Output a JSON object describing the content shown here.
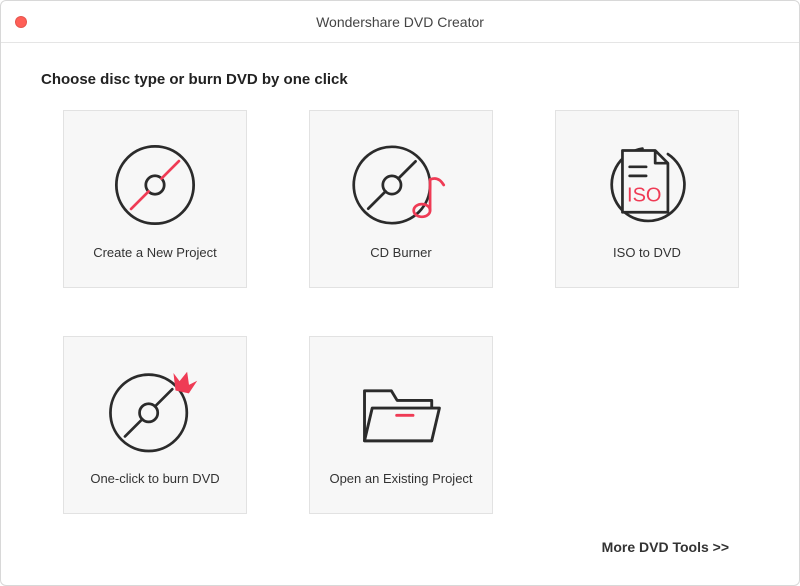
{
  "window": {
    "title": "Wondershare DVD Creator"
  },
  "heading": "Choose disc type or burn DVD by one click",
  "tiles": {
    "create_new_project": {
      "label": "Create a New Project"
    },
    "cd_burner": {
      "label": "CD Burner"
    },
    "iso_to_dvd": {
      "label": "ISO to DVD",
      "iso_text": "ISO"
    },
    "one_click_burn": {
      "label": "One-click to burn DVD"
    },
    "open_existing": {
      "label": "Open an Existing Project"
    }
  },
  "footer": {
    "more_tools": "More DVD Tools >>"
  },
  "colors": {
    "accent": "#ef3b55",
    "stroke": "#2b2b2b"
  }
}
